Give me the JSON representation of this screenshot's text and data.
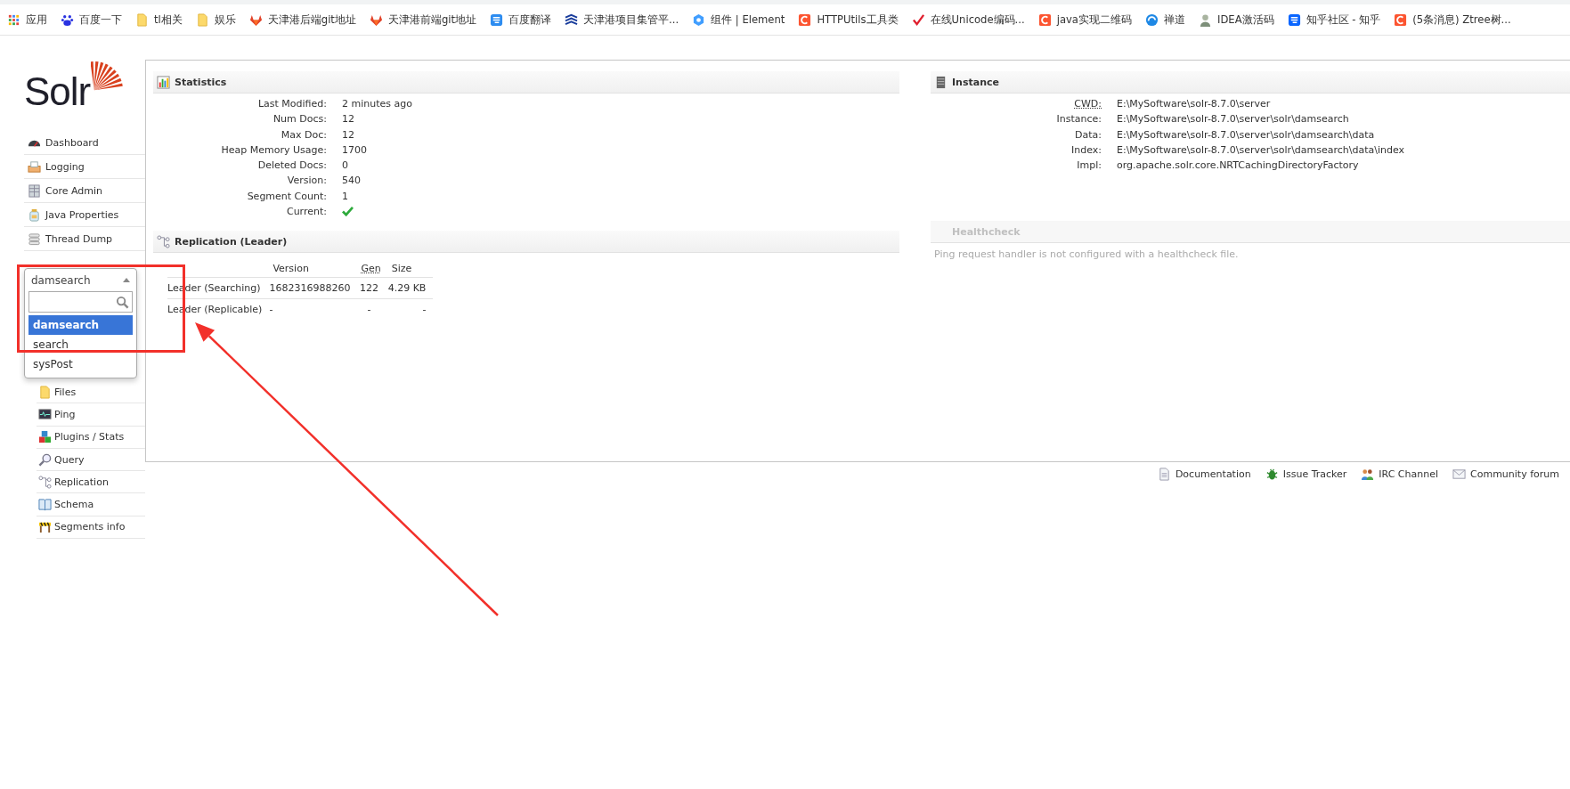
{
  "bookmarks": [
    {
      "label": "应用",
      "kind": "apps"
    },
    {
      "label": "百度一下",
      "kind": "baidu"
    },
    {
      "label": "tl相关",
      "kind": "folder"
    },
    {
      "label": "娱乐",
      "kind": "folder"
    },
    {
      "label": "天津港后端git地址",
      "kind": "gitlab"
    },
    {
      "label": "天津港前端git地址",
      "kind": "gitlab"
    },
    {
      "label": "百度翻译",
      "kind": "translate"
    },
    {
      "label": "天津港项目集管平...",
      "kind": "wave"
    },
    {
      "label": "组件 | Element",
      "kind": "element"
    },
    {
      "label": "HTTPUtils工具类",
      "kind": "csdn"
    },
    {
      "label": "在线Unicode编码...",
      "kind": "check"
    },
    {
      "label": "java实现二维码",
      "kind": "csdn"
    },
    {
      "label": "禅道",
      "kind": "swirl"
    },
    {
      "label": "IDEA激活码",
      "kind": "person"
    },
    {
      "label": "知乎社区 - 知乎",
      "kind": "zhihu"
    },
    {
      "label": "(5条消息) Ztree树...",
      "kind": "csdn"
    }
  ],
  "logo": {
    "text": "Solr"
  },
  "sidebar": {
    "items": [
      {
        "label": "Dashboard",
        "kind": "dashboard"
      },
      {
        "label": "Logging",
        "kind": "logging"
      },
      {
        "label": "Core Admin",
        "kind": "core_admin"
      },
      {
        "label": "Java Properties",
        "kind": "java"
      },
      {
        "label": "Thread Dump",
        "kind": "thread"
      }
    ]
  },
  "core_selector": {
    "value": "damsearch",
    "expanded": true,
    "options": [
      {
        "label": "damsearch",
        "selected": true
      },
      {
        "label": "search",
        "selected": false
      },
      {
        "label": "sysPost",
        "selected": false
      }
    ]
  },
  "core_menu": {
    "items": [
      {
        "label": "Files",
        "kind": "files"
      },
      {
        "label": "Ping",
        "kind": "ping"
      },
      {
        "label": "Plugins / Stats",
        "kind": "plugins"
      },
      {
        "label": "Query",
        "kind": "query"
      },
      {
        "label": "Replication",
        "kind": "replication"
      },
      {
        "label": "Schema",
        "kind": "schema"
      },
      {
        "label": "Segments info",
        "kind": "segments"
      }
    ]
  },
  "statistics": {
    "title": "Statistics",
    "rows": [
      {
        "label": "Last Modified:",
        "value": "2 minutes ago",
        "kind": "text"
      },
      {
        "label": "Num Docs:",
        "value": "12",
        "kind": "text"
      },
      {
        "label": "Max Doc:",
        "value": "12",
        "kind": "text"
      },
      {
        "label": "Heap Memory Usage:",
        "value": "1700",
        "kind": "text"
      },
      {
        "label": "Deleted Docs:",
        "value": "0",
        "kind": "text"
      },
      {
        "label": "Version:",
        "value": "540",
        "kind": "text"
      },
      {
        "label": "Segment Count:",
        "value": "1",
        "kind": "text"
      },
      {
        "label": "Current:",
        "checked": true,
        "kind": "check"
      }
    ]
  },
  "replication": {
    "title": "Replication (Leader)",
    "columns": [
      {
        "label": "Version",
        "abbr": false
      },
      {
        "label": "Gen",
        "abbr": true
      },
      {
        "label": "Size",
        "abbr": false
      }
    ],
    "rows": [
      {
        "label": "Leader (Searching)",
        "version": "1682316988260",
        "gen": "122",
        "size": "4.29 KB"
      },
      {
        "label": "Leader (Replicable)",
        "version": "-",
        "gen": "-",
        "size": "-"
      }
    ]
  },
  "instance": {
    "title": "Instance",
    "rows": [
      {
        "label": "CWD:",
        "abbr": true,
        "value": "E:\\MySoftware\\solr-8.7.0\\server"
      },
      {
        "label": "Instance:",
        "abbr": false,
        "value": "E:\\MySoftware\\solr-8.7.0\\server\\solr\\damsearch"
      },
      {
        "label": "Data:",
        "abbr": false,
        "value": "E:\\MySoftware\\solr-8.7.0\\server\\solr\\damsearch\\data"
      },
      {
        "label": "Index:",
        "abbr": false,
        "value": "E:\\MySoftware\\solr-8.7.0\\server\\solr\\damsearch\\data\\index"
      },
      {
        "label": "Impl:",
        "abbr": false,
        "value": "org.apache.solr.core.NRTCachingDirectoryFactory"
      }
    ]
  },
  "healthcheck": {
    "title": "Healthcheck",
    "disabled": true,
    "message": "Ping request handler is not configured with a healthcheck file."
  },
  "footer": {
    "links": [
      {
        "label": "Documentation",
        "kind": "doc"
      },
      {
        "label": "Issue Tracker",
        "kind": "bug"
      },
      {
        "label": "IRC Channel",
        "kind": "people"
      },
      {
        "label": "Community forum",
        "kind": "mail"
      }
    ]
  }
}
